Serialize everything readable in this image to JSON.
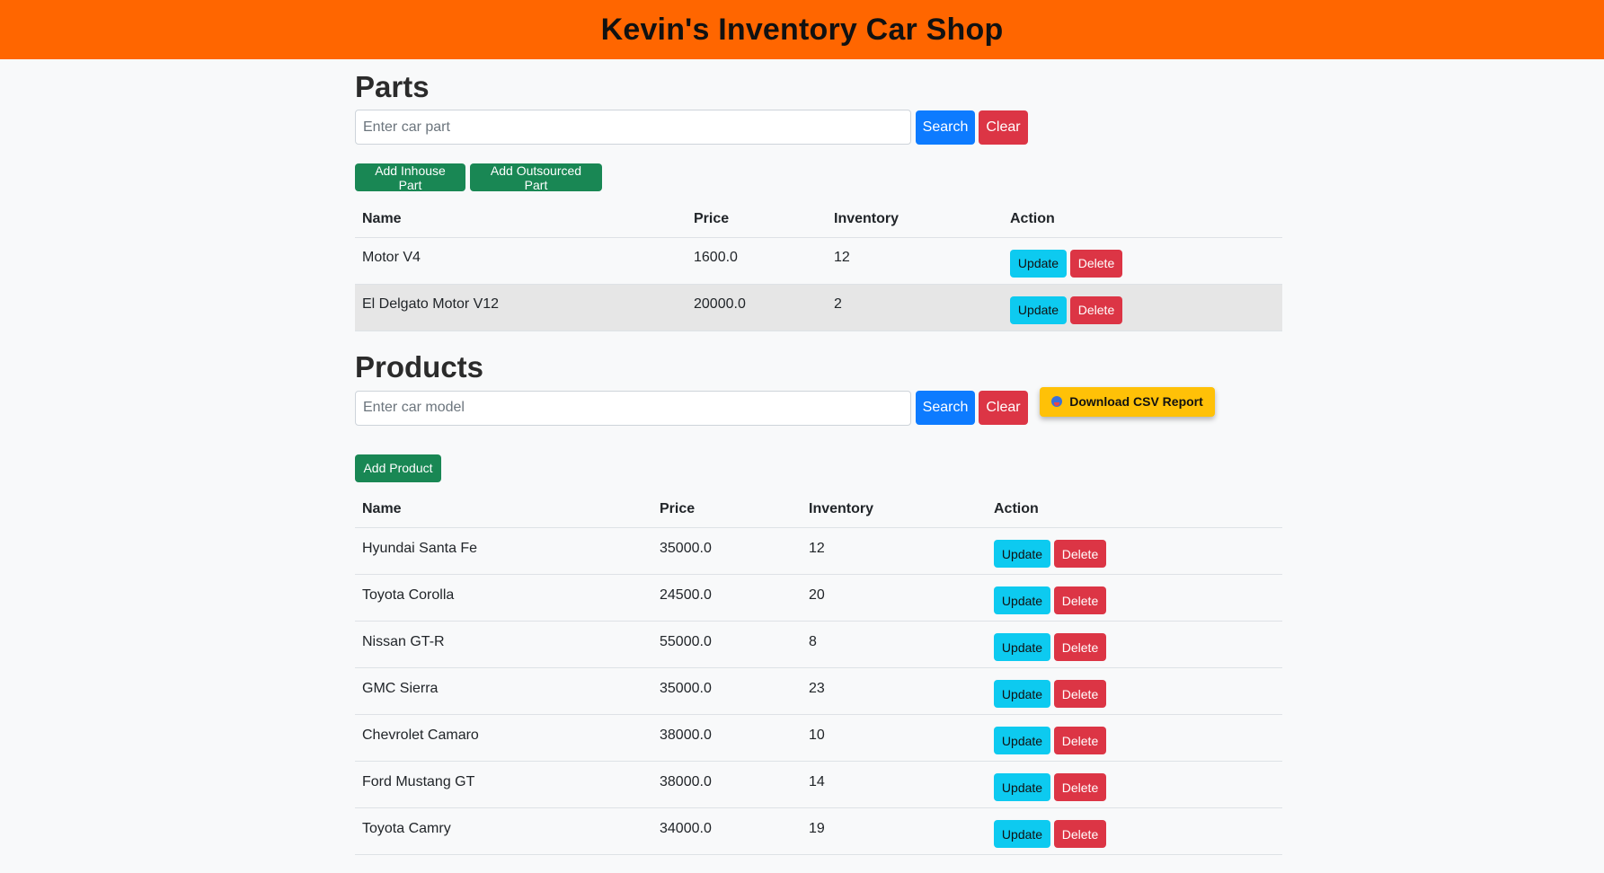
{
  "header": {
    "title": "Kevin's Inventory Car Shop"
  },
  "parts": {
    "title": "Parts",
    "search": {
      "placeholder": "Enter car part",
      "value": "",
      "search_label": "Search",
      "clear_label": "Clear"
    },
    "add_inhouse_label": "Add Inhouse Part",
    "add_outsourced_label": "Add Outsourced Part",
    "columns": {
      "name": "Name",
      "price": "Price",
      "inventory": "Inventory",
      "action": "Action"
    },
    "rows": [
      {
        "name": "Motor V4",
        "price": "1600.0",
        "inventory": "12",
        "update": "Update",
        "delete": "Delete"
      },
      {
        "name": "El Delgato Motor V12",
        "price": "20000.0",
        "inventory": "2",
        "update": "Update",
        "delete": "Delete"
      }
    ]
  },
  "products": {
    "title": "Products",
    "search": {
      "placeholder": "Enter car model",
      "value": "",
      "search_label": "Search",
      "clear_label": "Clear"
    },
    "csv_label": "Download CSV Report",
    "add_product_label": "Add Product",
    "columns": {
      "name": "Name",
      "price": "Price",
      "inventory": "Inventory",
      "action": "Action"
    },
    "rows": [
      {
        "name": "Hyundai Santa Fe",
        "price": "35000.0",
        "inventory": "12",
        "update": "Update",
        "delete": "Delete"
      },
      {
        "name": "Toyota Corolla",
        "price": "24500.0",
        "inventory": "20",
        "update": "Update",
        "delete": "Delete"
      },
      {
        "name": "Nissan GT-R",
        "price": "55000.0",
        "inventory": "8",
        "update": "Update",
        "delete": "Delete"
      },
      {
        "name": "GMC Sierra",
        "price": "35000.0",
        "inventory": "23",
        "update": "Update",
        "delete": "Delete"
      },
      {
        "name": "Chevrolet Camaro",
        "price": "38000.0",
        "inventory": "10",
        "update": "Update",
        "delete": "Delete"
      },
      {
        "name": "Ford Mustang GT",
        "price": "38000.0",
        "inventory": "14",
        "update": "Update",
        "delete": "Delete"
      },
      {
        "name": "Toyota Camry",
        "price": "34000.0",
        "inventory": "19",
        "update": "Update",
        "delete": "Delete"
      }
    ]
  },
  "colors": {
    "header_bg": "#ff6600",
    "search_button": "#0d7bff",
    "danger": "#dc3545",
    "success": "#198754",
    "info": "#0dcaf0",
    "warning": "#ffc107"
  },
  "icons": {
    "csv": "download-icon"
  }
}
